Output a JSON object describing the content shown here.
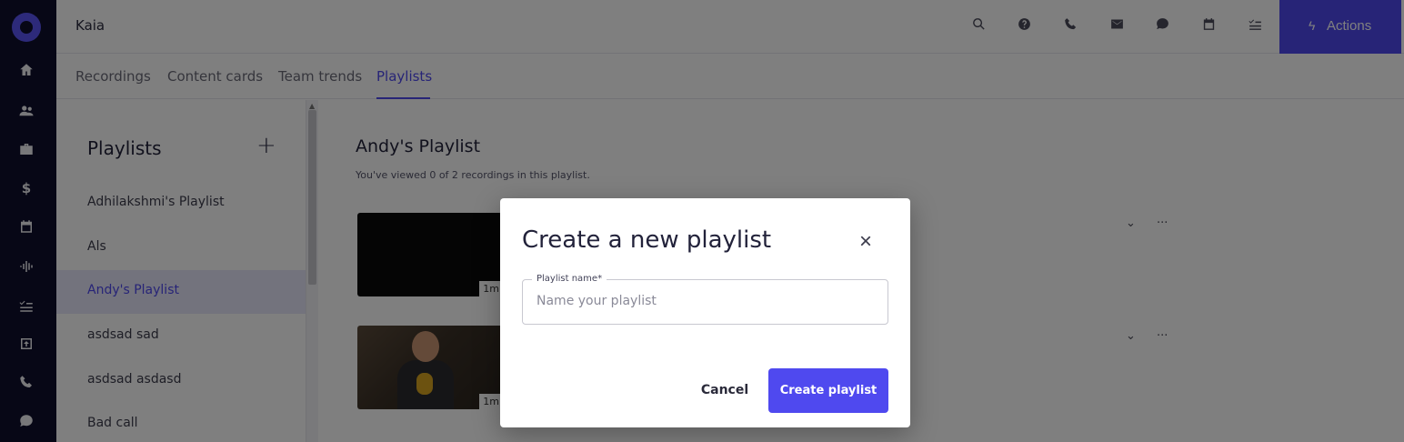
{
  "header": {
    "title": "Kaia",
    "actions_label": "Actions",
    "icons": [
      "search-icon",
      "help-icon",
      "phone-icon",
      "mail-icon",
      "chat-icon",
      "calendar-icon",
      "tasks-icon"
    ]
  },
  "rail": {
    "icons": [
      "logo",
      "home-icon",
      "people-icon",
      "briefcase-icon",
      "dollar-icon",
      "calendar-icon",
      "waveform-icon",
      "tasks-icon",
      "upload-icon",
      "phone-icon",
      "chat-icon"
    ]
  },
  "tabs": [
    {
      "label": "Recordings"
    },
    {
      "label": "Content cards"
    },
    {
      "label": "Team trends"
    },
    {
      "label": "Playlists",
      "active": true
    }
  ],
  "sidebar": {
    "title": "Playlists",
    "add_label": "+",
    "items": [
      {
        "label": "Adhilakshmi's Playlist"
      },
      {
        "label": "Als"
      },
      {
        "label": "Andy's Playlist",
        "active": true
      },
      {
        "label": "asdsad sad"
      },
      {
        "label": "asdsad asdasd"
      },
      {
        "label": "Bad call"
      }
    ]
  },
  "main": {
    "heading": "Andy's Playlist",
    "subtitle": "You've viewed 0 of 2 recordings in this playlist.",
    "recordings": [
      {
        "duration": "1m",
        "chevron": "⌄",
        "more": "···"
      },
      {
        "duration": "1m",
        "chevron": "⌄",
        "more": "···"
      }
    ]
  },
  "modal": {
    "title": "Create a new playlist",
    "close_label": "×",
    "field_label": "Playlist name*",
    "field_placeholder": "Name your playlist",
    "field_value": "",
    "cancel_label": "Cancel",
    "create_label": "Create playlist"
  },
  "colors": {
    "accent": "#4f49ef",
    "rail_bg": "#0e0f2c",
    "active_bg": "#e7e6fb"
  }
}
